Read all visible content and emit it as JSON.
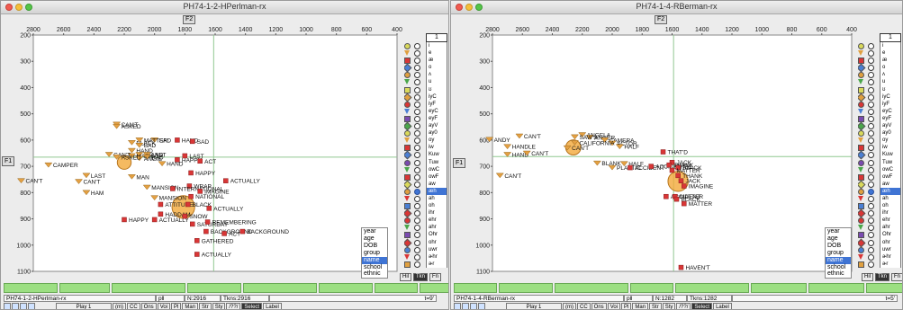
{
  "colors": {
    "accent": "#3f74d4",
    "marker_sq": "#d93636",
    "marker_tri": "#e4a042",
    "circle": "#f2a93a",
    "crosshair": "#90c890",
    "plot_bg": "#ffffff"
  },
  "left_window": {
    "title": "PH74-1-2-HPerlman-rx",
    "x_axis_label": "F2",
    "y_axis_label": "F1",
    "x_ticks": [
      "2800",
      "2600",
      "2400",
      "2200",
      "2000",
      "1800",
      "1600",
      "1400",
      "1200",
      "1000",
      "800",
      "600",
      "400"
    ],
    "y_ticks": [
      "200",
      "300",
      "400",
      "500",
      "600",
      "700",
      "800",
      "900",
      "1000",
      "1100"
    ],
    "vowel_header": "1",
    "vowels": [
      "i",
      "e",
      "æ",
      "o",
      "ʌ",
      "u",
      "ʊ",
      "iyC",
      "iyF",
      "eyC",
      "eyF",
      "ayV",
      "ay0",
      "oy",
      "iw",
      "Kuw",
      "Tuw",
      "owC",
      "owF",
      "aw",
      "æh",
      "ah",
      "oh",
      "ihr",
      "ehr",
      "ahr",
      "Ohr",
      "ohr",
      "uwr",
      "ɚhr",
      "ɚr"
    ],
    "selected_vowel": "æh",
    "sort_options": [
      "year",
      "age",
      "DOB",
      "group",
      "name",
      "school",
      "ethnic"
    ],
    "selected_sort": "name",
    "side_buttons": [
      "Hil",
      "Tkn",
      "Fn"
    ],
    "active_side_button": "Tkn",
    "status": {
      "file": "PH74-1-2-HPerlman-rx",
      "mode": "pll",
      "n": "N:2916",
      "tkns": "Tkns:2916",
      "t": "t=9'"
    },
    "toolbar": [
      "Play 1",
      "(m)",
      "CC",
      "Ons",
      "Voi",
      "Pl",
      "Man",
      "Str",
      "Sty",
      "/??/",
      "Select",
      "Label"
    ],
    "selected_tool": "Select",
    "points": [
      {
        "f2": 2250,
        "f1": 540,
        "label": "CAN'T",
        "m": "t"
      },
      {
        "f2": 2250,
        "f1": 548,
        "label": "ASKED",
        "m": "t"
      },
      {
        "f2": 2150,
        "f1": 610,
        "label": "BLACK",
        "m": "t"
      },
      {
        "f2": 2100,
        "f1": 620,
        "label": "BAD",
        "m": "t"
      },
      {
        "f2": 2000,
        "f1": 600,
        "label": "SAD",
        "m": "t"
      },
      {
        "f2": 2100,
        "f1": 600,
        "label": "MATTER",
        "m": "t"
      },
      {
        "f2": 2150,
        "f1": 640,
        "label": "HAND",
        "m": "t"
      },
      {
        "f2": 2100,
        "f1": 655,
        "label": "STAND",
        "m": "t"
      },
      {
        "f2": 2050,
        "f1": 655,
        "label": "LAST",
        "m": "t"
      },
      {
        "f2": 2150,
        "f1": 660,
        "label": "MASK",
        "m": "t"
      },
      {
        "f2": 2050,
        "f1": 665,
        "label": "BAD",
        "m": "t"
      },
      {
        "f2": 2100,
        "f1": 670,
        "label": "ANGIE",
        "m": "t"
      },
      {
        "f2": 2300,
        "f1": 655,
        "label": "CAN'T",
        "m": "t"
      },
      {
        "f2": 2250,
        "f1": 665,
        "label": "ASKED",
        "m": "t"
      },
      {
        "f2": 1850,
        "f1": 600,
        "label": "HAND",
        "m": "s"
      },
      {
        "f2": 1750,
        "f1": 605,
        "label": "SAD",
        "m": "s"
      },
      {
        "f2": 1800,
        "f1": 660,
        "label": "LAST",
        "m": "s"
      },
      {
        "f2": 1850,
        "f1": 675,
        "label": "HAPPY",
        "m": "s"
      },
      {
        "f2": 1700,
        "f1": 680,
        "label": "ACT",
        "m": "s"
      },
      {
        "f2": 1950,
        "f1": 690,
        "label": "HAND",
        "m": "t"
      },
      {
        "f2": 2700,
        "f1": 695,
        "label": "CAMPER",
        "m": "t"
      },
      {
        "f2": 2450,
        "f1": 735,
        "label": "LAST",
        "m": "t"
      },
      {
        "f2": 2500,
        "f1": 758,
        "label": "CAN'T",
        "m": "t"
      },
      {
        "f2": 2880,
        "f1": 755,
        "label": "CAN'T",
        "m": "t"
      },
      {
        "f2": 2150,
        "f1": 740,
        "label": "MAN",
        "m": "t"
      },
      {
        "f2": 2050,
        "f1": 780,
        "label": "MANSION",
        "m": "t"
      },
      {
        "f2": 2000,
        "f1": 820,
        "label": "MANSION",
        "m": "t"
      },
      {
        "f2": 2450,
        "f1": 800,
        "label": "HAM",
        "m": "t"
      },
      {
        "f2": 1760,
        "f1": 725,
        "label": "HAPPY",
        "m": "s"
      },
      {
        "f2": 1530,
        "f1": 755,
        "label": "ACTUALLY",
        "m": "s"
      },
      {
        "f2": 1770,
        "f1": 775,
        "label": "WRAP",
        "m": "s"
      },
      {
        "f2": 1880,
        "f1": 785,
        "label": "INTERNATIONAL",
        "m": "s"
      },
      {
        "f2": 1700,
        "f1": 795,
        "label": "IMAGINE",
        "m": "s"
      },
      {
        "f2": 1760,
        "f1": 815,
        "label": "NATIONAL",
        "m": "s"
      },
      {
        "f2": 1960,
        "f1": 845,
        "label": "ATTITUDE",
        "m": "s"
      },
      {
        "f2": 1780,
        "f1": 845,
        "label": "BLACK",
        "m": "s"
      },
      {
        "f2": 1640,
        "f1": 860,
        "label": "ACTUALLY",
        "m": "s"
      },
      {
        "f2": 1960,
        "f1": 882,
        "label": "HADDAM",
        "m": "s"
      },
      {
        "f2": 2200,
        "f1": 903,
        "label": "HAPPY",
        "m": "s"
      },
      {
        "f2": 2000,
        "f1": 903,
        "label": "ACTUALLY",
        "m": "s"
      },
      {
        "f2": 1800,
        "f1": 890,
        "label": "SNOW",
        "m": "s"
      },
      {
        "f2": 1750,
        "f1": 920,
        "label": "SATURDAY",
        "m": "s"
      },
      {
        "f2": 1650,
        "f1": 912,
        "label": "REMEMBERING",
        "m": "s"
      },
      {
        "f2": 1660,
        "f1": 948,
        "label": "BACKGROUND",
        "m": "s"
      },
      {
        "f2": 1420,
        "f1": 948,
        "label": "BACKGROUND",
        "m": "s"
      },
      {
        "f2": 1540,
        "f1": 956,
        "label": "ACT",
        "m": "s"
      },
      {
        "f2": 1720,
        "f1": 983,
        "label": "GATHERED",
        "m": "s"
      },
      {
        "f2": 1720,
        "f1": 1035,
        "label": "ACTUALLY",
        "m": "s"
      }
    ],
    "circles": [
      {
        "f2": 2200,
        "f1": 685,
        "r": 2.2
      },
      {
        "f2": 1810,
        "f1": 855,
        "r": 3.6
      }
    ]
  },
  "right_window": {
    "title": "PH74-1-4-RBerman-rx",
    "x_axis_label": "F2",
    "y_axis_label": "F1",
    "x_ticks": [
      "2800",
      "2600",
      "2400",
      "2200",
      "2000",
      "1800",
      "1600",
      "1400",
      "1200",
      "1000",
      "800",
      "600",
      "400"
    ],
    "y_ticks": [
      "200",
      "300",
      "400",
      "500",
      "600",
      "700",
      "800",
      "900",
      "1000",
      "1100"
    ],
    "vowel_header": "1",
    "vowels": [
      "i",
      "e",
      "æ",
      "o",
      "ʌ",
      "u",
      "ʊ",
      "iyC",
      "iyF",
      "eyC",
      "eyF",
      "ayV",
      "ay0",
      "oy",
      "iw",
      "Kuw",
      "Tuw",
      "owC",
      "owF",
      "aw",
      "æh",
      "ah",
      "oh",
      "ihr",
      "ehr",
      "ahr",
      "Ohr",
      "ohr",
      "uwr",
      "ɚhr",
      "ɚr"
    ],
    "selected_vowel": "æh",
    "sort_options": [
      "year",
      "age",
      "DOB",
      "group",
      "name",
      "school",
      "ethnic"
    ],
    "selected_sort": "name",
    "side_buttons": [
      "Hil",
      "Tkn",
      "Fn"
    ],
    "active_side_button": "Tkn",
    "status": {
      "file": "PH74-1-4-RBerman-rx",
      "mode": "pll",
      "n": "N:1282",
      "tkns": "Tkns:1282",
      "t": "t=5'"
    },
    "toolbar": [
      "Play 1",
      "(m)",
      "CC",
      "Ons",
      "Voi",
      "Pl",
      "Man",
      "Str",
      "Sty",
      "/??/",
      "Select",
      "Label"
    ],
    "selected_tool": "Select",
    "points": [
      {
        "f2": 2820,
        "f1": 598,
        "label": "ANDY",
        "m": "t"
      },
      {
        "f2": 2620,
        "f1": 585,
        "label": "CAN'T",
        "m": "t"
      },
      {
        "f2": 2700,
        "f1": 625,
        "label": "HANDLE",
        "m": "t"
      },
      {
        "f2": 2700,
        "f1": 655,
        "label": "HAND",
        "m": "t"
      },
      {
        "f2": 2570,
        "f1": 650,
        "label": "CAN'T",
        "m": "t"
      },
      {
        "f2": 2750,
        "f1": 735,
        "label": "CAN'T",
        "m": "t"
      },
      {
        "f2": 2200,
        "f1": 580,
        "label": "ANGELA",
        "m": "t"
      },
      {
        "f2": 2150,
        "f1": 590,
        "label": "ANGER",
        "m": "t"
      },
      {
        "f2": 2050,
        "f1": 600,
        "label": "CAMERA",
        "m": "t"
      },
      {
        "f2": 2000,
        "f1": 612,
        "label": "ACTOR",
        "m": "t"
      },
      {
        "f2": 2300,
        "f1": 630,
        "label": "CAN'T",
        "m": "t"
      },
      {
        "f2": 2250,
        "f1": 610,
        "label": "CALIFORNIA",
        "m": "t"
      },
      {
        "f2": 1950,
        "f1": 625,
        "label": "HALF",
        "m": "t"
      },
      {
        "f2": 2250,
        "f1": 588,
        "label": "SAW'S",
        "m": "t"
      },
      {
        "f2": 2100,
        "f1": 688,
        "label": "BLANK",
        "m": "t"
      },
      {
        "f2": 2000,
        "f1": 705,
        "label": "PLASTIC",
        "m": "t"
      },
      {
        "f2": 1920,
        "f1": 690,
        "label": "HALF",
        "m": "t"
      },
      {
        "f2": 1880,
        "f1": 705,
        "label": "ACCIDENT",
        "m": "s"
      },
      {
        "f2": 1740,
        "f1": 700,
        "label": "ACCIDENTAL",
        "m": "s"
      },
      {
        "f2": 1660,
        "f1": 645,
        "label": "THAT'D",
        "m": "s"
      },
      {
        "f2": 1600,
        "f1": 685,
        "label": "JACK",
        "m": "s"
      },
      {
        "f2": 1620,
        "f1": 695,
        "label": "THANK",
        "m": "s"
      },
      {
        "f2": 1560,
        "f1": 705,
        "label": "BLACK",
        "m": "s"
      },
      {
        "f2": 1600,
        "f1": 715,
        "label": "MATTER",
        "m": "s"
      },
      {
        "f2": 1560,
        "f1": 735,
        "label": "THANK",
        "m": "s"
      },
      {
        "f2": 1540,
        "f1": 755,
        "label": "JACK",
        "m": "s"
      },
      {
        "f2": 1520,
        "f1": 775,
        "label": "IMAGINE",
        "m": "s"
      },
      {
        "f2": 1640,
        "f1": 815,
        "label": "ACCIDENT",
        "m": "s"
      },
      {
        "f2": 1580,
        "f1": 815,
        "label": "MATTER",
        "m": "s"
      },
      {
        "f2": 1570,
        "f1": 825,
        "label": "BLACK",
        "m": "s"
      },
      {
        "f2": 1520,
        "f1": 842,
        "label": "MATTER",
        "m": "s"
      },
      {
        "f2": 1540,
        "f1": 1085,
        "label": "HAVEN'T",
        "m": "s"
      }
    ],
    "circles": [
      {
        "f2": 2260,
        "f1": 628,
        "r": 2.4
      },
      {
        "f2": 1560,
        "f1": 757,
        "r": 3.2
      }
    ]
  }
}
